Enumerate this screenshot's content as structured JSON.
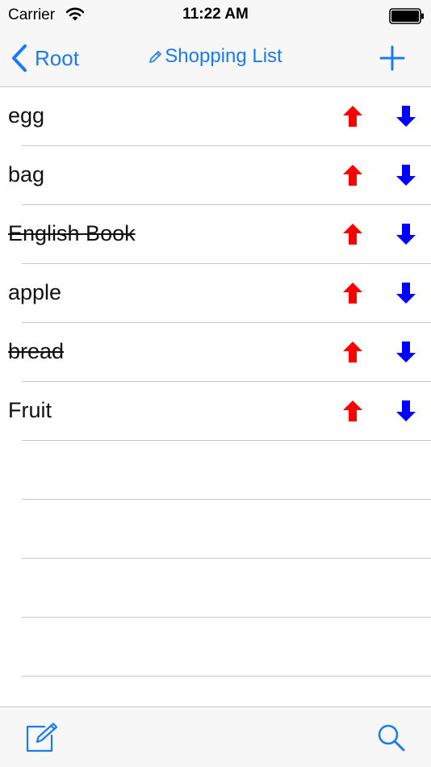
{
  "status_bar": {
    "carrier": "Carrier",
    "time": "11:22 AM",
    "wifi_icon": "wifi-icon",
    "battery_icon": "battery-icon"
  },
  "nav": {
    "back_label": "Root",
    "title": "Shopping List",
    "title_icon": "pencil-icon",
    "add_icon": "plus-icon"
  },
  "items": [
    {
      "label": "egg",
      "done": false
    },
    {
      "label": "bag",
      "done": false
    },
    {
      "label": "English Book",
      "done": true
    },
    {
      "label": "apple",
      "done": false
    },
    {
      "label": "bread",
      "done": true
    },
    {
      "label": "Fruit",
      "done": false
    }
  ],
  "empty_rows": 4,
  "toolbar": {
    "compose_icon": "compose-icon",
    "search_icon": "search-icon"
  },
  "colors": {
    "tint": "#1a7cf5",
    "up_arrow": "#ff0000",
    "down_arrow": "#0000ff",
    "bar_background": "#f7f7f8",
    "separator": "#c8c7cc"
  }
}
